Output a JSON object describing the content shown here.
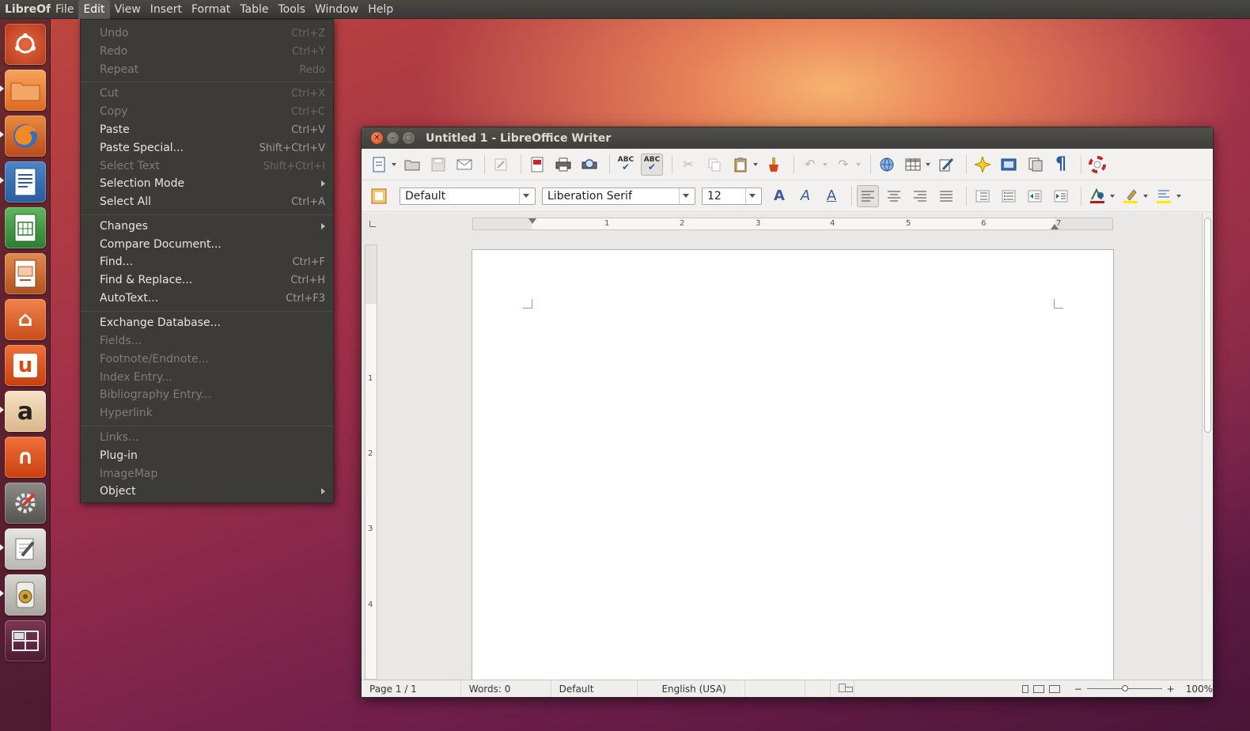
{
  "top_panel": {
    "app_name": "LibreOf",
    "menus": [
      "File",
      "Edit",
      "View",
      "Insert",
      "Format",
      "Table",
      "Tools",
      "Window",
      "Help"
    ],
    "active_menu": "Edit"
  },
  "launcher": {
    "items": [
      {
        "name": "dash-home",
        "color": "#d9502b"
      },
      {
        "name": "files",
        "color": "#e7793a"
      },
      {
        "name": "firefox",
        "color": "#e9742e"
      },
      {
        "name": "libreoffice-writer",
        "color": "#3573b8"
      },
      {
        "name": "libreoffice-calc",
        "color": "#43a047"
      },
      {
        "name": "libreoffice-impress",
        "color": "#c8642e"
      },
      {
        "name": "software-center",
        "color": "#dd6126"
      },
      {
        "name": "ubuntu-one",
        "color": "#dd4814"
      },
      {
        "name": "amazon",
        "color": "#b87a2e"
      },
      {
        "name": "ubuntu-one-music",
        "color": "#dd4814"
      },
      {
        "name": "system-settings",
        "color": "#8a3a3a"
      },
      {
        "name": "text-editor",
        "color": "#9a9a98"
      },
      {
        "name": "sound-recorder",
        "color": "#a8a6a0"
      },
      {
        "name": "workspace-switcher",
        "color": "#6a2a40"
      }
    ],
    "glyphs": {
      "software-center": "⌂",
      "ubuntu-one": "u",
      "amazon": "a",
      "ubuntu-one-music": "∩"
    }
  },
  "edit_menu": {
    "items": [
      {
        "label": "Undo",
        "shortcut": "Ctrl+Z",
        "disabled": true
      },
      {
        "label": "Redo",
        "shortcut": "Ctrl+Y",
        "disabled": true
      },
      {
        "label": "Repeat",
        "shortcut": "Redo",
        "disabled": true
      },
      {
        "label": "Cut",
        "shortcut": "Ctrl+X",
        "disabled": true
      },
      {
        "label": "Copy",
        "shortcut": "Ctrl+C",
        "disabled": true
      },
      {
        "label": "Paste",
        "shortcut": "Ctrl+V",
        "disabled": false
      },
      {
        "label": "Paste Special...",
        "shortcut": "Shift+Ctrl+V",
        "disabled": false
      },
      {
        "label": "Select Text",
        "shortcut": "Shift+Ctrl+I",
        "disabled": true
      },
      {
        "label": "Selection Mode",
        "shortcut": "",
        "disabled": false,
        "submenu": true
      },
      {
        "label": "Select All",
        "shortcut": "Ctrl+A",
        "disabled": false
      },
      {
        "label": "Changes",
        "shortcut": "",
        "disabled": false,
        "submenu": true
      },
      {
        "label": "Compare Document...",
        "shortcut": "",
        "disabled": false
      },
      {
        "label": "Find...",
        "shortcut": "Ctrl+F",
        "disabled": false
      },
      {
        "label": "Find & Replace...",
        "shortcut": "Ctrl+H",
        "disabled": false
      },
      {
        "label": "AutoText...",
        "shortcut": "Ctrl+F3",
        "disabled": false
      },
      {
        "label": "Exchange Database...",
        "shortcut": "",
        "disabled": false
      },
      {
        "label": "Fields...",
        "shortcut": "",
        "disabled": true
      },
      {
        "label": "Footnote/Endnote...",
        "shortcut": "",
        "disabled": true
      },
      {
        "label": "Index Entry...",
        "shortcut": "",
        "disabled": true
      },
      {
        "label": "Bibliography Entry...",
        "shortcut": "",
        "disabled": true
      },
      {
        "label": "Hyperlink",
        "shortcut": "",
        "disabled": true
      },
      {
        "label": "Links...",
        "shortcut": "",
        "disabled": true
      },
      {
        "label": "Plug-in",
        "shortcut": "",
        "disabled": false
      },
      {
        "label": "ImageMap",
        "shortcut": "",
        "disabled": true
      },
      {
        "label": "Object",
        "shortcut": "",
        "disabled": false,
        "submenu": true
      }
    ]
  },
  "writer": {
    "title": "Untitled 1 - LibreOffice Writer",
    "toolbar": {
      "spell_check_label": "ABC",
      "autospell_label": "ABC",
      "pilcrow": "¶"
    },
    "formatting": {
      "paragraph_style": "Default",
      "font_name": "Liberation Serif",
      "font_size": "12",
      "bold_glyph": "A",
      "italic_glyph": "A",
      "underline_glyph": "A"
    },
    "ruler": {
      "h_numbers": [
        "1",
        "2",
        "3",
        "4",
        "5",
        "6",
        "7"
      ],
      "v_numbers": [
        "1",
        "2",
        "3",
        "4"
      ]
    },
    "status": {
      "page": "Page 1 / 1",
      "words": "Words: 0",
      "style": "Default",
      "language": "English (USA)",
      "zoom": "100%",
      "zoom_minus": "−",
      "zoom_plus": "+"
    }
  }
}
